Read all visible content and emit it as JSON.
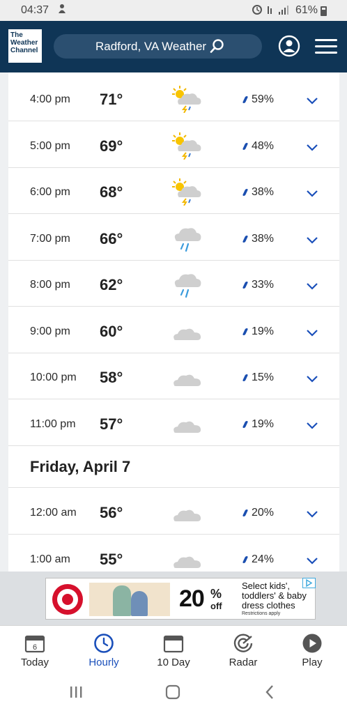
{
  "status_bar": {
    "time": "04:37",
    "battery": "61%"
  },
  "header": {
    "logo_lines": [
      "The",
      "Weather",
      "Channel"
    ],
    "search_label": "Radford, VA Weather"
  },
  "hourly_before": [
    {
      "time": "4:00 pm",
      "temp": "71°",
      "icon": "partly-sunny-thunderstorm-icon",
      "precip": "59%"
    },
    {
      "time": "5:00 pm",
      "temp": "69°",
      "icon": "partly-sunny-thunderstorm-icon",
      "precip": "48%"
    },
    {
      "time": "6:00 pm",
      "temp": "68°",
      "icon": "partly-sunny-thunderstorm-icon",
      "precip": "38%"
    },
    {
      "time": "7:00 pm",
      "temp": "66°",
      "icon": "rain-cloud-icon",
      "precip": "38%"
    },
    {
      "time": "8:00 pm",
      "temp": "62°",
      "icon": "rain-cloud-icon",
      "precip": "33%"
    },
    {
      "time": "9:00 pm",
      "temp": "60°",
      "icon": "cloud-icon",
      "precip": "19%"
    },
    {
      "time": "10:00 pm",
      "temp": "58°",
      "icon": "cloud-icon",
      "precip": "15%"
    },
    {
      "time": "11:00 pm",
      "temp": "57°",
      "icon": "cloud-icon",
      "precip": "19%"
    }
  ],
  "day_header": "Friday, April 7",
  "hourly_after": [
    {
      "time": "12:00 am",
      "temp": "56°",
      "icon": "cloud-icon",
      "precip": "20%"
    },
    {
      "time": "1:00 am",
      "temp": "55°",
      "icon": "cloud-icon",
      "precip": "24%"
    }
  ],
  "ad": {
    "percent": "20",
    "percent_sign": "%",
    "off": "off",
    "copy": "Select kids', toddlers' & baby dress clothes",
    "fine_print": "Restrictions apply"
  },
  "bottom_nav": [
    {
      "label": "Today",
      "icon": "calendar-day-icon",
      "badge": "6"
    },
    {
      "label": "Hourly",
      "icon": "clock-icon",
      "active": true
    },
    {
      "label": "10 Day",
      "icon": "calendar-icon"
    },
    {
      "label": "Radar",
      "icon": "radar-icon"
    },
    {
      "label": "Play",
      "icon": "play-icon"
    }
  ],
  "colors": {
    "header": "#0f3556",
    "accent": "#1a4fba",
    "precip": "#1b4fb0"
  }
}
